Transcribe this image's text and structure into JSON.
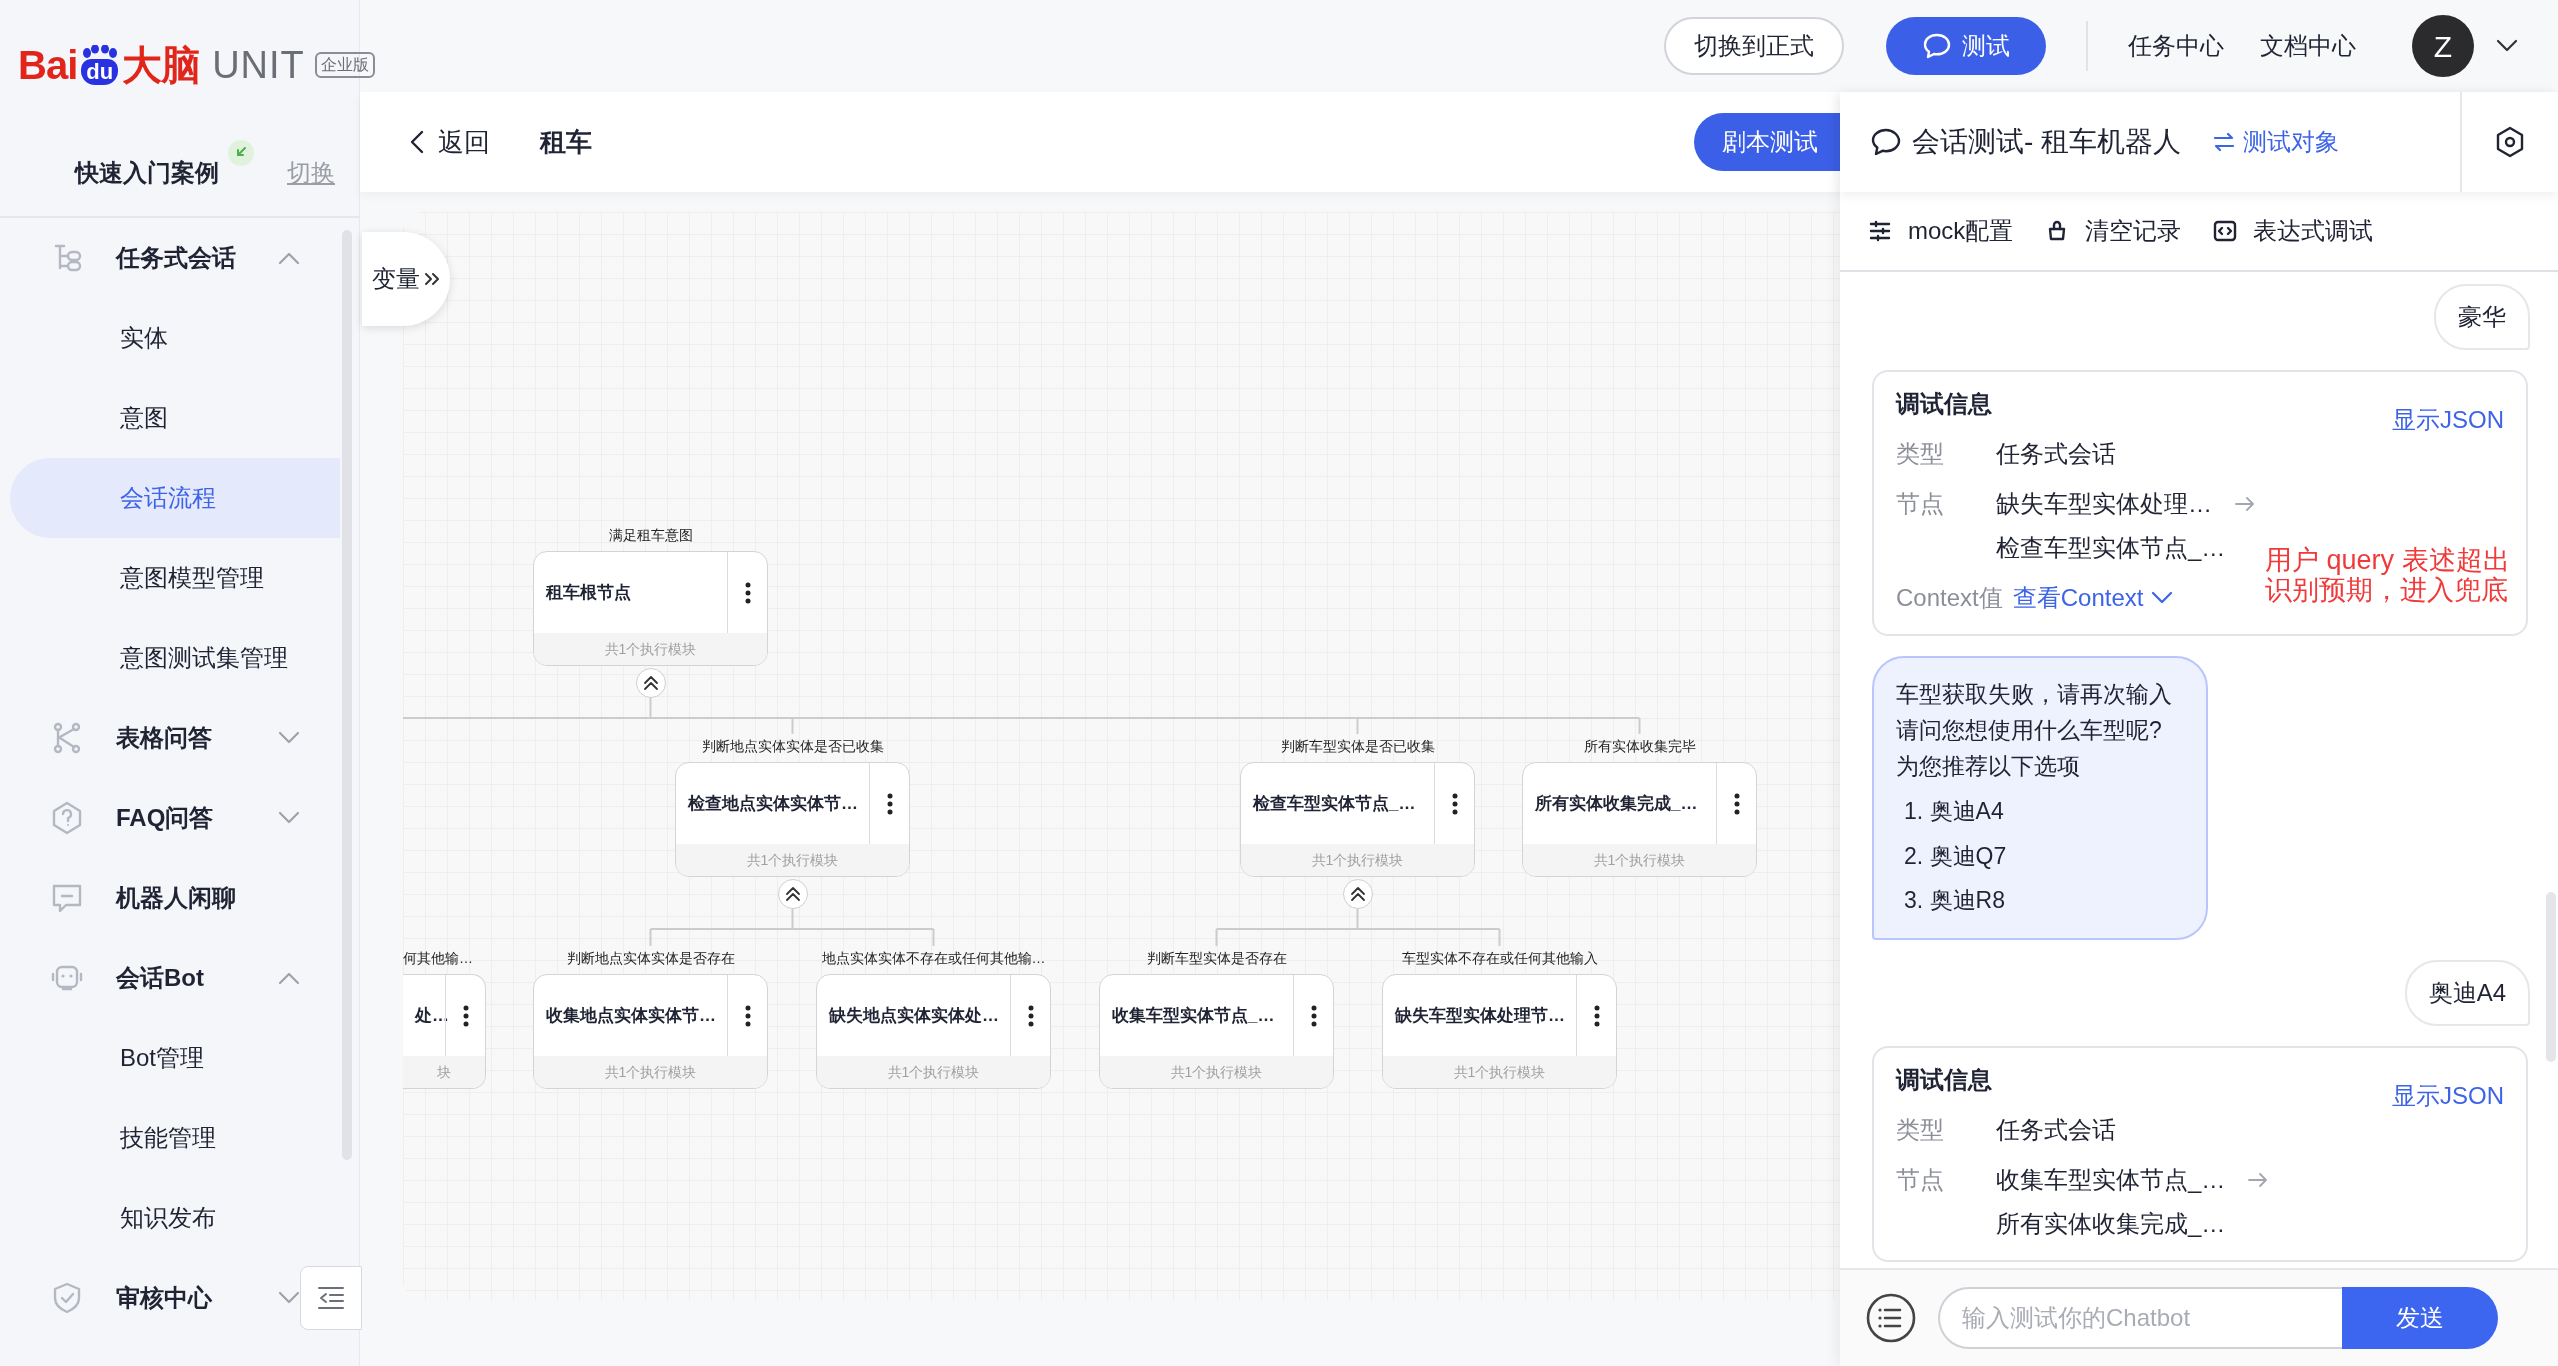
{
  "logo": {
    "brand_left": "Bai",
    "brand_mark": "du",
    "brand_right": "大脑",
    "product": "UNIT",
    "edition": "企业版"
  },
  "project": {
    "name": "快速入门案例",
    "switch_label": "切换"
  },
  "sidebar": {
    "items": [
      {
        "kind": "group",
        "label": "任务式会话",
        "expanded": true,
        "children": [
          {
            "label": "实体",
            "selected": false
          },
          {
            "label": "意图",
            "selected": false
          },
          {
            "label": "会话流程",
            "selected": true
          },
          {
            "label": "意图模型管理",
            "selected": false
          },
          {
            "label": "意图测试集管理",
            "selected": false
          }
        ]
      },
      {
        "kind": "group",
        "label": "表格问答",
        "expanded": false
      },
      {
        "kind": "group",
        "label": "FAQ问答",
        "expanded": false
      },
      {
        "kind": "page",
        "label": "机器人闲聊"
      },
      {
        "kind": "group",
        "label": "会话Bot",
        "expanded": true,
        "children": [
          {
            "label": "Bot管理",
            "selected": false
          },
          {
            "label": "技能管理",
            "selected": false
          },
          {
            "label": "知识发布",
            "selected": false
          }
        ]
      },
      {
        "kind": "group",
        "label": "审核中心",
        "expanded": false
      }
    ]
  },
  "topbar": {
    "buttons": [
      {
        "kind": "outline",
        "label": "切换到正式"
      },
      {
        "kind": "primary",
        "label": "测试"
      }
    ],
    "links": [
      "任务中心",
      "文档中心"
    ],
    "avatar": "Z"
  },
  "page_header": {
    "back": "返回",
    "title": "租车",
    "action": "剧本测试"
  },
  "canvas": {
    "variable_tab": "变量",
    "root": {
      "label": "满足租车意图",
      "title": "租车根节点",
      "footer": "共1个执行模块",
      "children": [
        {
          "label": "判断地点实体实体是否已收集",
          "title": "检查地点实体实体节…",
          "footer": "共1个执行模块",
          "children": [
            {
              "label": "判断地点实体实体是否存在",
              "title": "收集地点实体实体节…",
              "footer": "共1个执行模块"
            },
            {
              "label": "地点实体实体不存在或任何其他输…",
              "title": "缺失地点实体实体处…",
              "footer": "共1个执行模块"
            }
          ]
        },
        {
          "label": "判断车型实体是否已收集",
          "title": "检查车型实体节点_…",
          "footer": "共1个执行模块",
          "children": [
            {
              "label": "判断车型实体是否存在",
              "title": "收集车型实体节点_…",
              "footer": "共1个执行模块"
            },
            {
              "label": "车型实体不存在或任何其他输入",
              "title": "缺失车型实体处理节…",
              "footer": "共1个执行模块"
            }
          ]
        },
        {
          "label": "所有实体收集完毕",
          "title": "所有实体收集完成_…",
          "footer": "共1个执行模块"
        }
      ]
    },
    "clipped_nodes": [
      {
        "label": "何其他输…",
        "title": "处…",
        "footer": "块"
      }
    ]
  },
  "test_panel": {
    "title": "会话测试- 租车机器人",
    "target_link": "测试对象",
    "tools": [
      "mock配置",
      "清空记录",
      "表达式调试"
    ],
    "messages": [
      {
        "kind": "user",
        "text": "豪华"
      },
      {
        "kind": "debug",
        "title": "调试信息",
        "json_link": "显示JSON",
        "rows": [
          {
            "kind": "text",
            "label": "类型",
            "values": [
              "任务式会话"
            ]
          },
          {
            "kind": "nodes",
            "label": "节点",
            "values": [
              "缺失车型实体处理…",
              "检查车型实体节点_…"
            ]
          },
          {
            "kind": "link",
            "label": "Context值",
            "values": [
              "查看Context"
            ]
          }
        ]
      },
      {
        "kind": "bot",
        "lines": [
          "车型获取失败，请再次输入",
          "请问您想使用什么车型呢?",
          "为您推荐以下选项"
        ],
        "options": [
          {
            "number": "1.",
            "text": "奥迪A4"
          },
          {
            "number": "2.",
            "text": "奥迪Q7"
          },
          {
            "number": "3.",
            "text": "奥迪R8"
          }
        ]
      },
      {
        "kind": "user",
        "text": "奥迪A4"
      },
      {
        "kind": "debug",
        "title": "调试信息",
        "json_link": "显示JSON",
        "rows": [
          {
            "kind": "text",
            "label": "类型",
            "values": [
              "任务式会话"
            ]
          },
          {
            "kind": "nodes",
            "label": "节点",
            "values": [
              "收集车型实体节点_…",
              "所有实体收集完成_…"
            ]
          }
        ]
      }
    ],
    "annotation": {
      "lines": [
        "用户 query 表述超出",
        "识别预期，进入兜底"
      ]
    },
    "input": {
      "placeholder": "输入测试你的Chatbot"
    },
    "send": "发送"
  }
}
